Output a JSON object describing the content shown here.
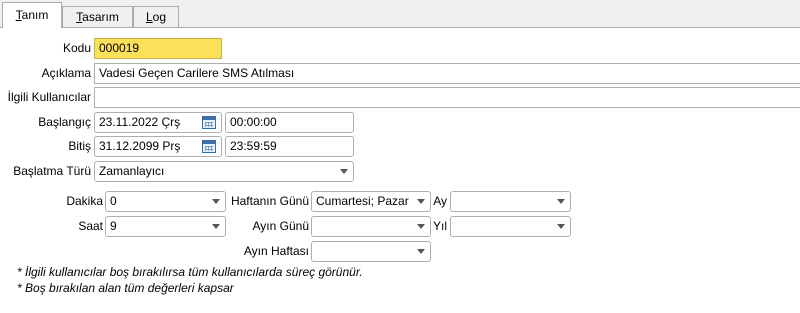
{
  "tabs": [
    {
      "label": "Tanım",
      "accel": "T",
      "rest": "anım"
    },
    {
      "label": "Tasarım",
      "accel": "T",
      "rest": "asarım"
    },
    {
      "label": "Log",
      "accel": "L",
      "rest": "og"
    }
  ],
  "active_tab": "Tanım",
  "form": {
    "kodu": {
      "label": "Kodu",
      "value": "000019"
    },
    "aciklama": {
      "label": "Açıklama",
      "value": "Vadesi Geçen Carilere SMS Atılması"
    },
    "ilgili": {
      "label": "İlgili Kullanıcılar",
      "value": ""
    },
    "baslangic": {
      "label": "Başlangıç",
      "date": "23.11.2022 Çrş",
      "time": "00:00:00"
    },
    "bitis": {
      "label": "Bitiş",
      "date": "31.12.2099 Prş",
      "time": "23:59:59"
    },
    "baslatma": {
      "label": "Başlatma Türü",
      "value": "Zamanlayıcı"
    }
  },
  "schedule": {
    "dakika": {
      "label": "Dakika",
      "value": "0"
    },
    "saat": {
      "label": "Saat",
      "value": "9"
    },
    "haftanin_gunu": {
      "label": "Haftanın Günü",
      "value": "Cumartesi; Pazar"
    },
    "ayin_gunu": {
      "label": "Ayın Günü",
      "value": ""
    },
    "ayin_haftasi": {
      "label": "Ayın Haftası",
      "value": ""
    },
    "ay": {
      "label": "Ay",
      "value": ""
    },
    "yil": {
      "label": "Yıl",
      "value": ""
    }
  },
  "notes": [
    "* İlgili kullanıcılar boş bırakılırsa tüm kullanıcılarda süreç görünür.",
    "* Boş bırakılan alan tüm değerleri kapsar"
  ],
  "colors": {
    "highlight_field": "#fbe05a"
  }
}
